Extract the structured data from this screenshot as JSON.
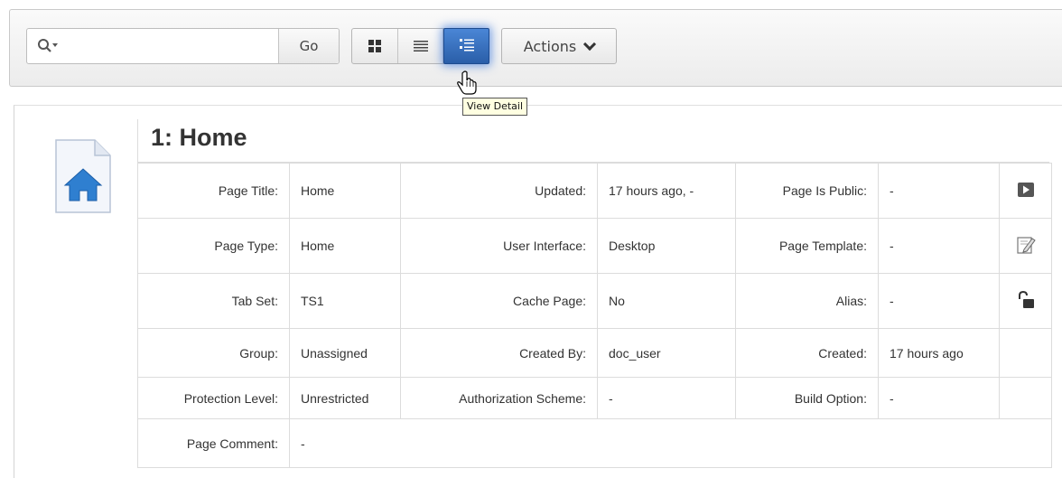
{
  "toolbar": {
    "search_placeholder": "",
    "search_value": "",
    "go_label": "Go",
    "view_buttons": [
      "icon-view",
      "report-view",
      "detail-view"
    ],
    "active_view": "detail-view",
    "actions_label": "Actions"
  },
  "tooltip": "View Detail",
  "page": {
    "heading": "1: Home",
    "icon": "home-page-icon"
  },
  "properties": [
    [
      {
        "label": "Page Title:",
        "value": "Home"
      },
      {
        "label": "Updated:",
        "value": "17 hours ago, -"
      },
      {
        "label": "Page Is Public:",
        "value": "-"
      },
      {
        "action": "run-page-icon"
      }
    ],
    [
      {
        "label": "Page Type:",
        "value": "Home"
      },
      {
        "label": "User Interface:",
        "value": "Desktop"
      },
      {
        "label": "Page Template:",
        "value": "-"
      },
      {
        "action": "edit-page-icon"
      }
    ],
    [
      {
        "label": "Tab Set:",
        "value": "TS1"
      },
      {
        "label": "Cache Page:",
        "value": "No"
      },
      {
        "label": "Alias:",
        "value": "-"
      },
      {
        "action": "unlock-icon"
      }
    ],
    [
      {
        "label": "Group:",
        "value": "Unassigned"
      },
      {
        "label": "Created By:",
        "value": "doc_user"
      },
      {
        "label": "Created:",
        "value": "17 hours ago"
      }
    ],
    [
      {
        "label": "Protection Level:",
        "value": "Unrestricted"
      },
      {
        "label": "Authorization Scheme:",
        "value": "-"
      },
      {
        "label": "Build Option:",
        "value": "-"
      }
    ],
    [
      {
        "label": "Page Comment:",
        "value": "-"
      }
    ]
  ],
  "colors": {
    "active_view_button": "#2f66b3",
    "border": "#dcdcdc",
    "page_icon_blue": "#2f7fd0"
  }
}
